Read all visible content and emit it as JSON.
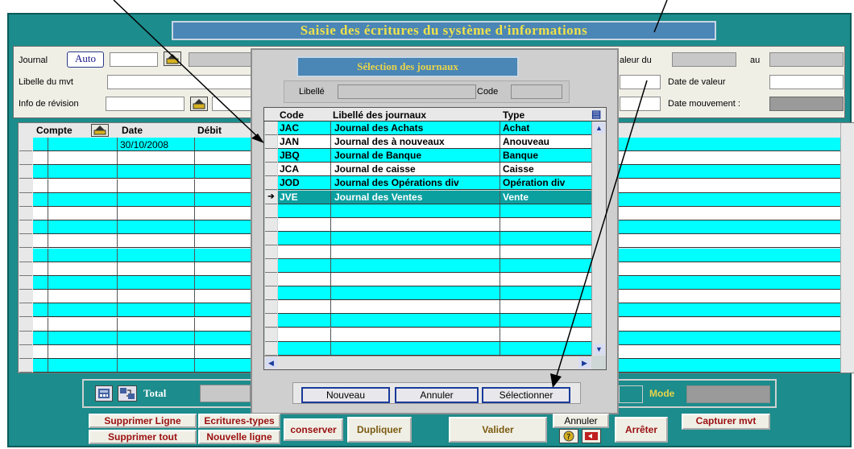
{
  "window": {
    "title": "Saisie des écritures du système d'informations"
  },
  "header_form": {
    "journal_label": "Journal",
    "auto_button": "Auto",
    "libelle_mvt_label": "Libelle du mvt",
    "info_revision_label": "Info de révision",
    "valeur_du_label": "aleur du",
    "au_label": "au",
    "date_valeur_label": "Date de valeur",
    "date_mouvement_label": "Date mouvement :"
  },
  "main_grid": {
    "columns": [
      "Compte",
      "Date",
      "Débit"
    ],
    "first_row_date": "30/10/2008"
  },
  "modal": {
    "title": "Sélection des journaux",
    "libelle_label": "Libellé",
    "code_label": "Code",
    "columns": [
      "Code",
      "Libellé des journaux",
      "Type"
    ],
    "rows": [
      {
        "code": "JAC",
        "libelle": "Journal des Achats",
        "type": "Achat"
      },
      {
        "code": "JAN",
        "libelle": "Journal des à nouveaux",
        "type": "Anouveau"
      },
      {
        "code": "JBQ",
        "libelle": "Journal de Banque",
        "type": "Banque"
      },
      {
        "code": "JCA",
        "libelle": "Journal de caisse",
        "type": "Caisse"
      },
      {
        "code": "JOD",
        "libelle": "Journal des Opérations div",
        "type": "Opération div"
      },
      {
        "code": "JVE",
        "libelle": "Journal des Ventes",
        "type": "Vente"
      }
    ],
    "selected_index": 5,
    "buttons": {
      "nouveau": "Nouveau",
      "annuler": "Annuler",
      "selectionner": "Sélectionner"
    }
  },
  "footer": {
    "total_label": "Total",
    "mode_label": "Mode",
    "buttons": {
      "supprimer_ligne": "Supprimer Ligne",
      "ecritures_types": "Ecritures-types",
      "supprimer_tout": "Supprimer tout",
      "nouvelle_ligne": "Nouvelle ligne",
      "conserver": "conserver",
      "dupliquer": "Dupliquer",
      "valider": "Valider",
      "annuler": "Annuler",
      "arreter": "Arrêter",
      "capturer_mvt": "Capturer mvt"
    }
  },
  "colors": {
    "teal": "#1c8c8c",
    "cyan_row": "#00ffff",
    "title_blue": "#4a86b6",
    "title_gold": "#f0e24a",
    "button_red": "#9a1010"
  }
}
